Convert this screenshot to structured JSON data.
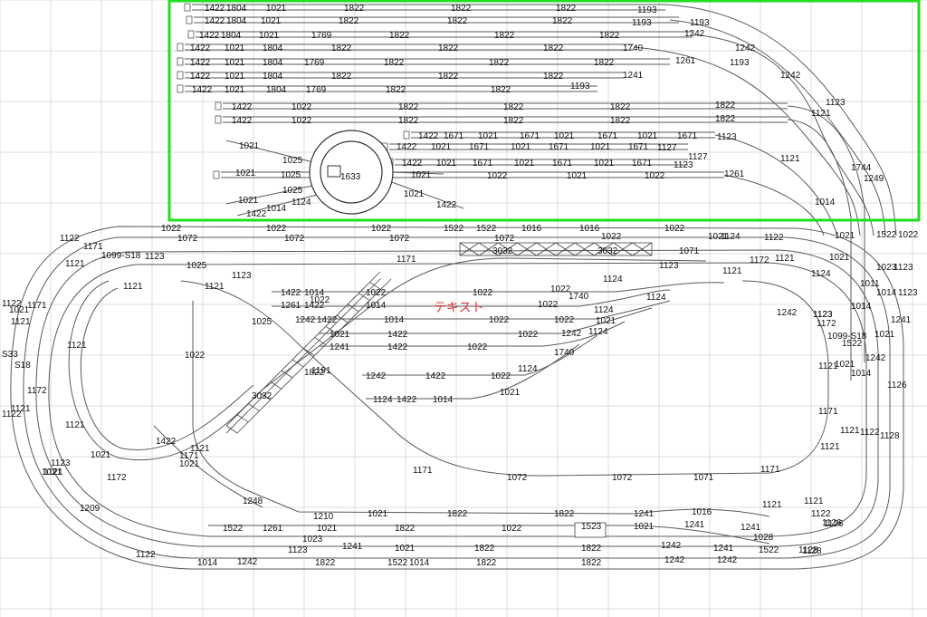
{
  "canvas": {
    "background": "#ffffff",
    "grid_color": "#d8dde3",
    "selection_color": "#22dd22",
    "text_color": "#e23a3a"
  },
  "annotation_text": "テキスト",
  "turntable_label": "1633",
  "labels": {
    "yard_row1": [
      "1422",
      "1804",
      "1021",
      "1822",
      "1822",
      "1822",
      "1193"
    ],
    "yard_row2": [
      "1422",
      "1804",
      "1021",
      "1822",
      "1822",
      "1822",
      "1193",
      "1193"
    ],
    "yard_row3": [
      "1422",
      "1804",
      "1021",
      "1769",
      "1822",
      "1822",
      "1822",
      "1242"
    ],
    "yard_row4": [
      "1422",
      "1021",
      "1804",
      "1822",
      "1822",
      "1822",
      "1740",
      "1242"
    ],
    "yard_row5": [
      "1422",
      "1021",
      "1804",
      "1769",
      "1822",
      "1822",
      "1822",
      "1261",
      "1193"
    ],
    "yard_row6": [
      "1422",
      "1021",
      "1804",
      "1822",
      "1822",
      "1822",
      "1241",
      "1242"
    ],
    "yard_row7": [
      "1422",
      "1021",
      "1804",
      "1769",
      "1822",
      "1822",
      "1193"
    ],
    "yard_row8": [
      "1422",
      "1022",
      "1822",
      "1822",
      "1822",
      "1822",
      "1123"
    ],
    "yard_row9": [
      "1422",
      "1022",
      "1822",
      "1822",
      "1822",
      "1822",
      "1121"
    ],
    "yard_row10": [
      "1422",
      "1671",
      "1021",
      "1671",
      "1021",
      "1671",
      "1021",
      "1671",
      "1123"
    ],
    "yard_row11": [
      "1422",
      "1021",
      "1671",
      "1021",
      "1671",
      "1021",
      "1671",
      "1127"
    ],
    "yard_row12": [
      "1422",
      "1021",
      "1671",
      "1021",
      "1671",
      "1021",
      "1671",
      "1127",
      "1123"
    ],
    "yard_row13": [
      "1021",
      "1025",
      "1633",
      "1021",
      "1022",
      "1021",
      "1022",
      "1261"
    ],
    "turntable_spurs": [
      "1021",
      "1025",
      "1025",
      "1021",
      "1124",
      "1014",
      "1422",
      "1021",
      "1422"
    ],
    "right_loop": [
      "1121",
      "1014",
      "1744",
      "1249",
      "1021",
      "1522",
      "1022",
      "1021",
      "1023",
      "1123",
      "1011",
      "1014",
      "1123",
      "1014",
      "1241",
      "1021",
      "1242",
      "1126",
      "1128"
    ],
    "main_top": [
      "1122",
      "1022",
      "1022",
      "1022",
      "1522",
      "1522",
      "1016",
      "1016",
      "1022",
      "1122",
      "1072",
      "1072",
      "1072",
      "1072",
      "1022",
      "1021",
      "1124"
    ],
    "main_upper": [
      "1171",
      "1099-S18",
      "1123",
      "1025",
      "1123",
      "1171",
      "3032",
      "3032",
      "1071",
      "1172",
      "1121",
      "1123",
      "1121",
      "1124"
    ],
    "middle_yard": [
      "1422",
      "1014",
      "1022",
      "1022",
      "1022",
      "1740",
      "1124",
      "1261",
      "1422",
      "1014",
      "1022",
      "1124",
      "1242",
      "1422",
      "1014",
      "1022",
      "1022",
      "1124",
      "1021",
      "1422",
      "1022",
      "1021",
      "1242",
      "1124",
      "1241",
      "1422",
      "1022",
      "1740",
      "1242",
      "1422",
      "1022",
      "1124",
      "1124",
      "1422",
      "1014",
      "1021",
      "1191",
      "1022",
      "1022"
    ],
    "left_loop": [
      "1121",
      "1121",
      "1121",
      "1121",
      "1171",
      "1121",
      "1172",
      "1121",
      "1121",
      "1123",
      "1021",
      "1209",
      "1122",
      "1122",
      "1121",
      "S33",
      "S18",
      "1022",
      "1025",
      "1822",
      "3032",
      "1021",
      "1422",
      "1121",
      "1171",
      "1021",
      "1172",
      "1021"
    ],
    "right_inner": [
      "1242",
      "1123",
      "1172",
      "1099-S18",
      "1522",
      "1121",
      "1021",
      "1014",
      "1171",
      "1121",
      "1121",
      "1122",
      "1126",
      "1128",
      "1123"
    ],
    "bottom": [
      "1171",
      "1072",
      "1072",
      "1071",
      "1171",
      "1248",
      "1021",
      "1822",
      "1822",
      "1241",
      "1016",
      "1121",
      "1210",
      "1021",
      "1822",
      "1022",
      "1523",
      "1021",
      "1241",
      "1241",
      "1122",
      "1121",
      "1522",
      "1261",
      "1023",
      "1241",
      "1021",
      "1822",
      "1822",
      "1242",
      "1241",
      "1028",
      "1122",
      "1123",
      "1014",
      "1242",
      "1822",
      "1522",
      "1014",
      "1822",
      "1822",
      "1242",
      "1242",
      "1522",
      "1128",
      "1126"
    ]
  }
}
